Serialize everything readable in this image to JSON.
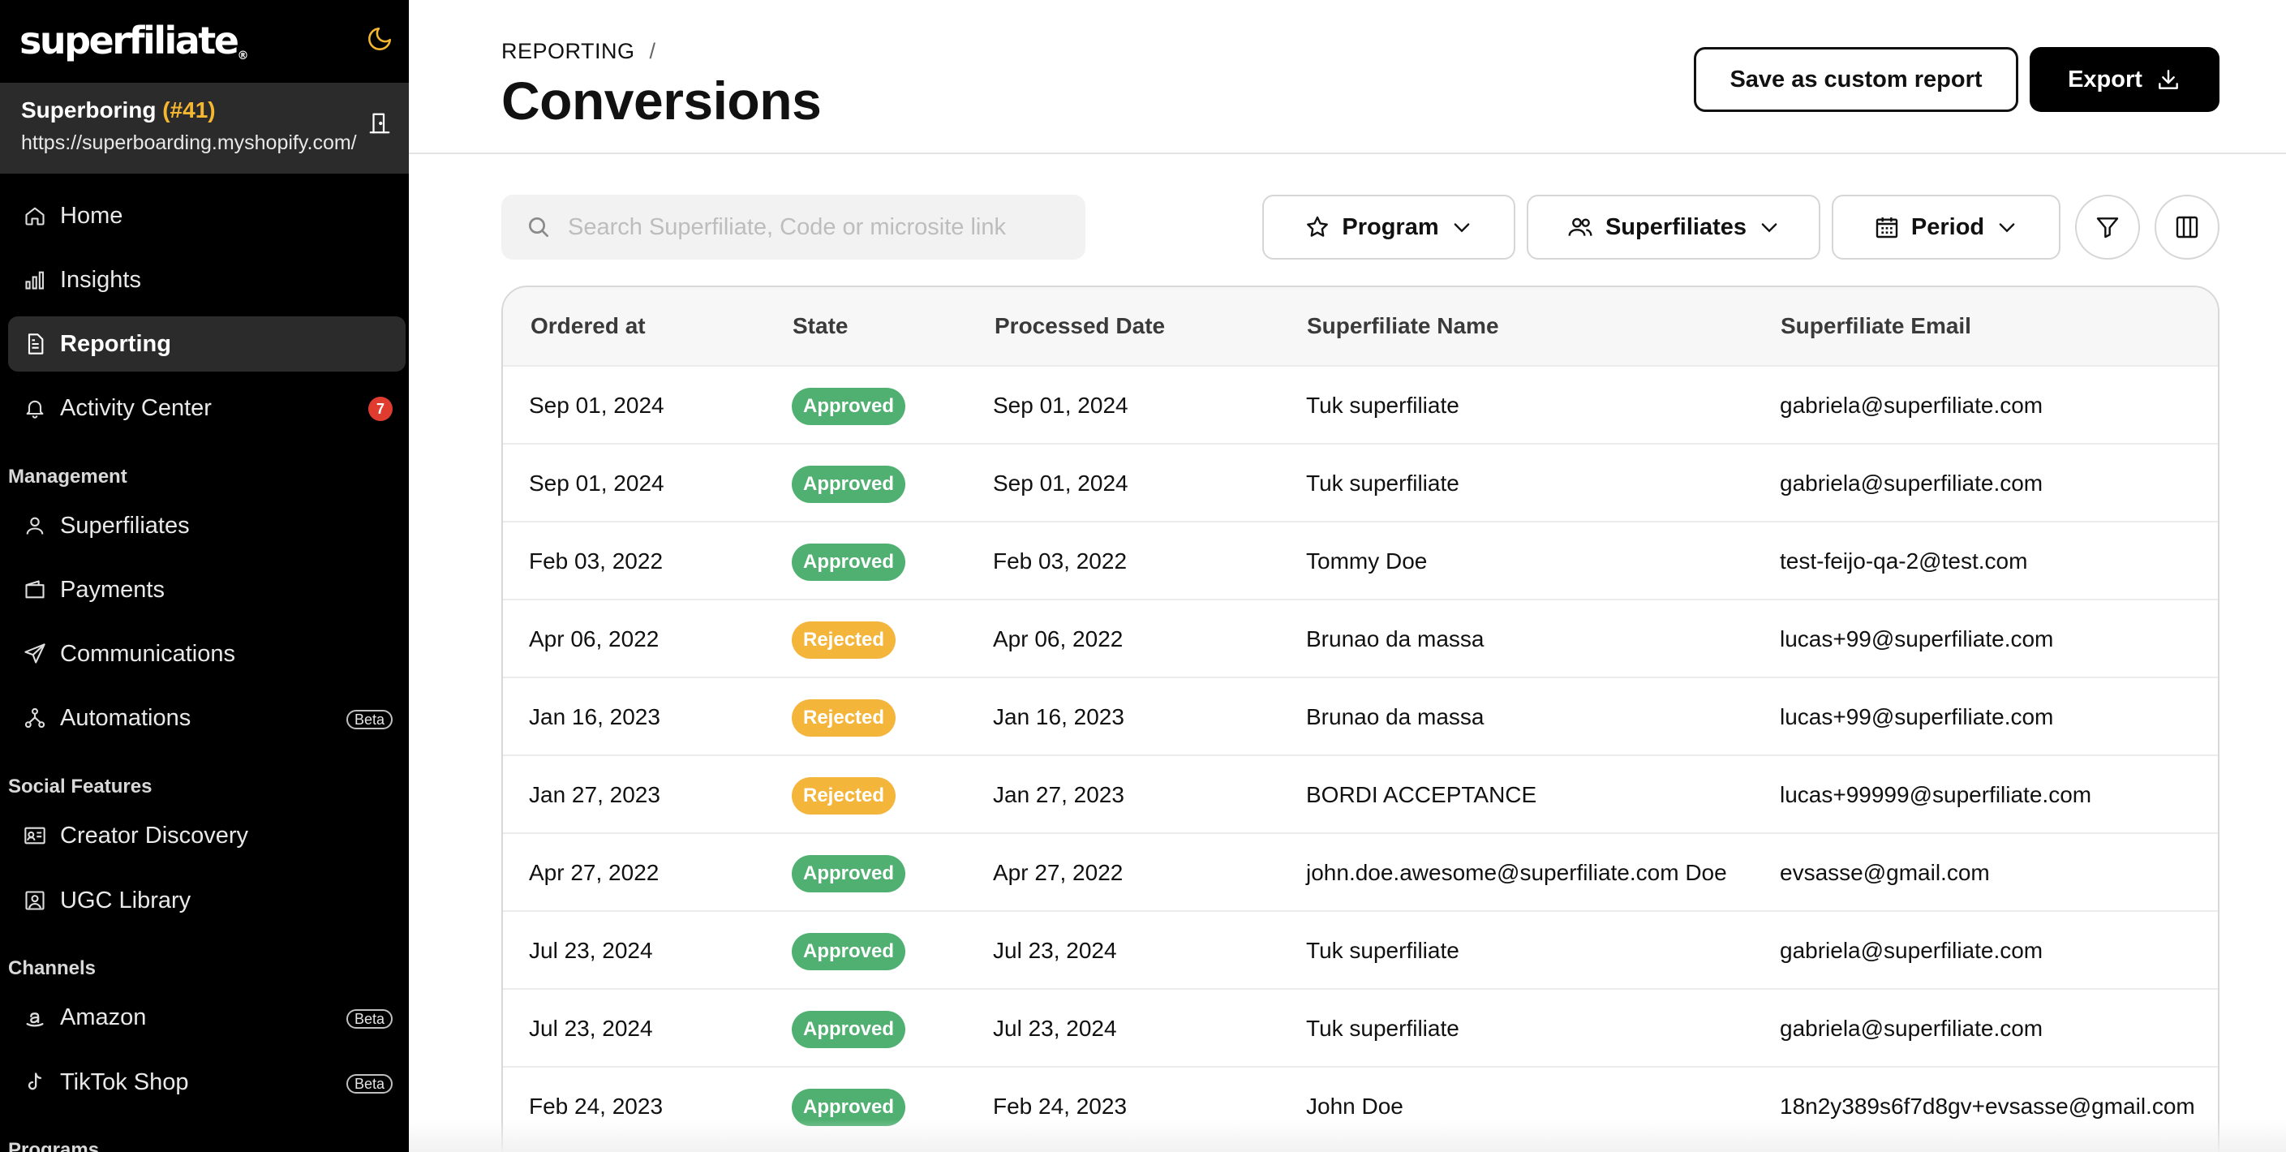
{
  "brand": {
    "name": "superfiliate",
    "mark": "®"
  },
  "store": {
    "name": "Superboring",
    "number": "(#41)",
    "url": "https://superboarding.myshopify.com/"
  },
  "nav": {
    "top": [
      {
        "label": "Home",
        "icon": "home-icon"
      },
      {
        "label": "Insights",
        "icon": "bar-chart-icon"
      },
      {
        "label": "Reporting",
        "icon": "document-icon",
        "active": true
      },
      {
        "label": "Activity Center",
        "icon": "bell-icon",
        "badge": "7"
      }
    ],
    "management_title": "Management",
    "management": [
      {
        "label": "Superfiliates",
        "icon": "user-icon"
      },
      {
        "label": "Payments",
        "icon": "wallet-icon"
      },
      {
        "label": "Communications",
        "icon": "send-icon"
      },
      {
        "label": "Automations",
        "icon": "automation-icon",
        "beta": "Beta"
      }
    ],
    "social_title": "Social Features",
    "social": [
      {
        "label": "Creator Discovery",
        "icon": "id-card-icon"
      },
      {
        "label": "UGC Library",
        "icon": "image-icon"
      }
    ],
    "channels_title": "Channels",
    "channels": [
      {
        "label": "Amazon",
        "icon": "amazon-icon",
        "beta": "Beta"
      },
      {
        "label": "TikTok Shop",
        "icon": "tiktok-icon",
        "beta": "Beta"
      }
    ],
    "programs_title": "Programs"
  },
  "header": {
    "breadcrumb": "REPORTING",
    "separator": "/",
    "title": "Conversions",
    "save_label": "Save as custom report",
    "export_label": "Export"
  },
  "toolbar": {
    "search_placeholder": "Search Superfiliate, Code or microsite link",
    "program_label": "Program",
    "superfiliates_label": "Superfiliates",
    "period_label": "Period"
  },
  "table": {
    "columns": [
      "Ordered at",
      "State",
      "Processed Date",
      "Superfiliate Name",
      "Superfiliate Email"
    ],
    "rows": [
      {
        "ordered": "Sep 01, 2024",
        "state": "Approved",
        "processed": "Sep 01, 2024",
        "name": "Tuk superfiliate",
        "email": "gabriela@superfiliate.com"
      },
      {
        "ordered": "Sep 01, 2024",
        "state": "Approved",
        "processed": "Sep 01, 2024",
        "name": "Tuk superfiliate",
        "email": "gabriela@superfiliate.com"
      },
      {
        "ordered": "Feb 03, 2022",
        "state": "Approved",
        "processed": "Feb 03, 2022",
        "name": "Tommy Doe",
        "email": "test-feijo-qa-2@test.com"
      },
      {
        "ordered": "Apr 06, 2022",
        "state": "Rejected",
        "processed": "Apr 06, 2022",
        "name": "Brunao da massa",
        "email": "lucas+99@superfiliate.com"
      },
      {
        "ordered": "Jan 16, 2023",
        "state": "Rejected",
        "processed": "Jan 16, 2023",
        "name": "Brunao da massa",
        "email": "lucas+99@superfiliate.com"
      },
      {
        "ordered": "Jan 27, 2023",
        "state": "Rejected",
        "processed": "Jan 27, 2023",
        "name": "BORDI ACCEPTANCE",
        "email": "lucas+99999@superfiliate.com"
      },
      {
        "ordered": "Apr 27, 2022",
        "state": "Approved",
        "processed": "Apr 27, 2022",
        "name": "john.doe.awesome@superfiliate.com Doe",
        "email": "evsasse@gmail.com"
      },
      {
        "ordered": "Jul 23, 2024",
        "state": "Approved",
        "processed": "Jul 23, 2024",
        "name": "Tuk superfiliate",
        "email": "gabriela@superfiliate.com"
      },
      {
        "ordered": "Jul 23, 2024",
        "state": "Approved",
        "processed": "Jul 23, 2024",
        "name": "Tuk superfiliate",
        "email": "gabriela@superfiliate.com"
      },
      {
        "ordered": "Feb 24, 2023",
        "state": "Approved",
        "processed": "Feb 24, 2023",
        "name": "John Doe",
        "email": "18n2y389s6f7d8gv+evsasse@gmail.com"
      }
    ]
  },
  "colors": {
    "sidebar_bg": "#000000",
    "sidebar_active": "#2b2b2b",
    "accent_yellow": "#f5b731",
    "approved": "#4fb071",
    "rejected": "#f3b53a",
    "badge_red": "#e03b2f"
  }
}
